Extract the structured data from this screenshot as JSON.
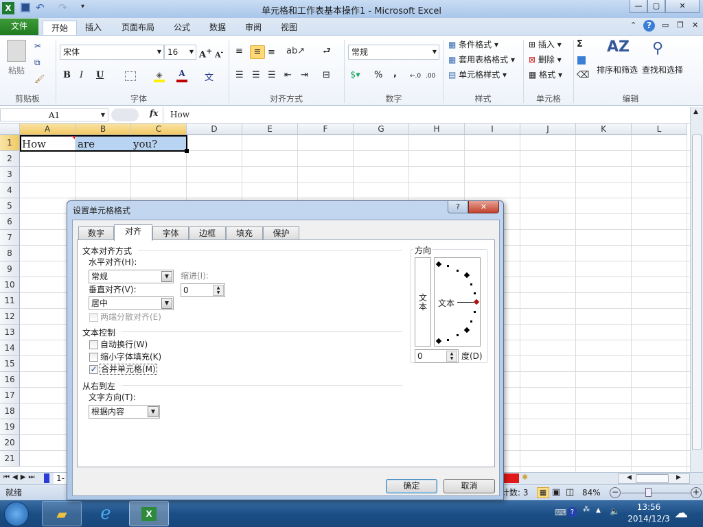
{
  "window": {
    "title": "单元格和工作表基本操作1 - Microsoft Excel",
    "min": "—",
    "max": "▢",
    "close": "✕"
  },
  "qat": {
    "app_icon": "excel-icon",
    "save": "save-icon",
    "undo": "undo-icon",
    "redo": "redo-icon",
    "customize": "▾"
  },
  "ribbon_tabs": [
    {
      "label": "文件"
    },
    {
      "label": "开始"
    },
    {
      "label": "插入"
    },
    {
      "label": "页面布局"
    },
    {
      "label": "公式"
    },
    {
      "label": "数据"
    },
    {
      "label": "审阅"
    },
    {
      "label": "视图"
    }
  ],
  "ribbon": {
    "clipboard": {
      "label": "剪贴板",
      "paste": "粘贴"
    },
    "font": {
      "label": "字体",
      "name": "宋体",
      "size": "16",
      "bold": "B",
      "italic": "I",
      "underline": "U"
    },
    "alignment": {
      "label": "对齐方式"
    },
    "number": {
      "label": "数字",
      "format": "常规",
      "percent": "%",
      "comma": ","
    },
    "styles": {
      "label": "样式",
      "items": [
        "条件格式",
        "套用表格格式",
        "单元格样式"
      ]
    },
    "cells": {
      "label": "单元格",
      "items": [
        "插入",
        "删除",
        "格式"
      ]
    },
    "editing": {
      "label": "编辑",
      "sort": "排序和筛选",
      "find": "查找和选择",
      "sum": "Σ"
    }
  },
  "formula_bar": {
    "name_box": "A1",
    "fx": "fx",
    "value": "How"
  },
  "sheet": {
    "columns": [
      "A",
      "B",
      "C",
      "D",
      "E",
      "F",
      "G",
      "H",
      "I",
      "J",
      "K",
      "L"
    ],
    "rows": [
      "1",
      "2",
      "3",
      "4",
      "5",
      "6",
      "7",
      "8",
      "9",
      "10",
      "11",
      "12",
      "13",
      "14",
      "15",
      "16",
      "17",
      "18",
      "19",
      "20",
      "21"
    ],
    "cells": {
      "A1": "How",
      "B1": "are",
      "C1": "you?"
    },
    "tab": "1-"
  },
  "status": {
    "ready": "就绪",
    "count": "计数: 3",
    "zoom": "84%"
  },
  "dialog": {
    "title": "设置单元格格式",
    "tabs": [
      "数字",
      "对齐",
      "字体",
      "边框",
      "填充",
      "保护"
    ],
    "active_tab": "对齐",
    "text_alignment": {
      "section": "文本对齐方式",
      "horizontal_label": "水平对齐(H):",
      "horizontal_value": "常规",
      "vertical_label": "垂直对齐(V):",
      "vertical_value": "居中",
      "indent_label": "缩进(I):",
      "indent_value": "0",
      "justify_distributed": "两端分散对齐(E)"
    },
    "text_control": {
      "section": "文本控制",
      "wrap": "自动换行(W)",
      "wrap_checked": false,
      "shrink": "缩小字体填充(K)",
      "shrink_checked": false,
      "merge": "合并单元格(M)",
      "merge_checked": true
    },
    "rtl": {
      "section": "从右到左",
      "direction_label": "文字方向(T):",
      "direction_value": "根据内容"
    },
    "orientation": {
      "section": "方向",
      "vertical_text": "文本",
      "dial_text": "文本",
      "degrees_value": "0",
      "degrees_label": "度(D)"
    },
    "ok": "确定",
    "cancel": "取消"
  },
  "taskbar": {
    "time": "13:56",
    "date": "2014/12/3"
  }
}
